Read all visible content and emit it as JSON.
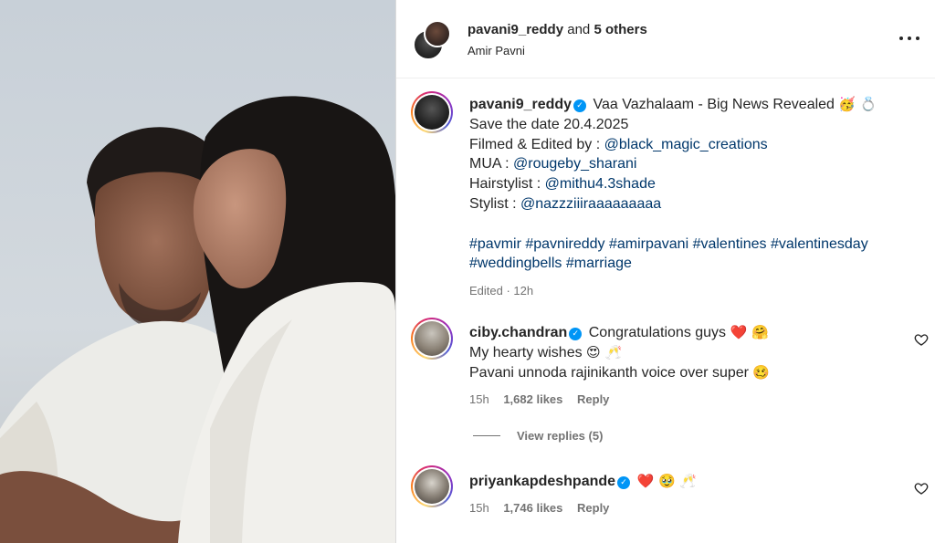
{
  "post": {
    "header": {
      "user": "pavani9_reddy",
      "and_text": " and ",
      "others": "5 others",
      "subtitle": "Amir Pavni",
      "more_icon": "more-horizontal-icon"
    },
    "caption": {
      "username": "pavani9_reddy",
      "verified_icon": "verified-badge-icon",
      "verified_glyph": "✓",
      "title": " Vaa Vazhalaam - Big News Revealed ",
      "title_emoji": "🥳 💍",
      "line_date": "Save the date 20.4.2025",
      "filmed_label": "Filmed & Edited by : ",
      "filmed_link": "@black_magic_creations",
      "mua_label": "MUA : ",
      "mua_link": "@rougeby_sharani",
      "hair_label": "Hairstylist : ",
      "hair_link": "@mithu4.3shade",
      "stylist_label": "Stylist : ",
      "stylist_link": "@nazzziiiraaaaaaaaa",
      "hashtags_line1": "#pavmir #pavnireddy #amirpavani #valentines #valentinesday",
      "hashtags_line2": "#weddingbells #marriage",
      "edited": "Edited · 12h"
    },
    "comments": [
      {
        "username": "ciby.chandran",
        "text_line1": " Congratulations guys ",
        "emoji_line1": "❤️ 🤗",
        "text_line2": "My hearty wishes ",
        "emoji_line2": "😍 🥂",
        "text_line3": "Pavani unnoda rajinikanth voice over super ",
        "emoji_line3": "🥴",
        "time": "15h",
        "likes": "1,682 likes",
        "reply": "Reply",
        "view_replies": "View replies (5)"
      },
      {
        "username": "priyankapdeshpande",
        "text_line1": " ",
        "emoji_line1": "❤️ 🥹 🥂",
        "time": "15h",
        "likes": "1,746 likes",
        "reply": "Reply"
      }
    ],
    "icons": {
      "like": "heart-outline-icon"
    },
    "colors": {
      "link": "#00376b",
      "verified": "#0095f6",
      "muted": "#737373"
    }
  }
}
